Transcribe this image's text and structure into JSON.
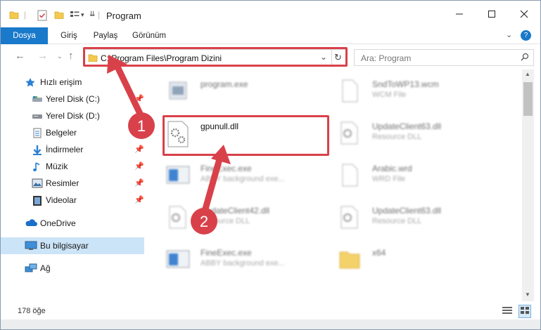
{
  "window": {
    "title": "Program",
    "minimize_icon": "minimize-icon",
    "maximize_icon": "maximize-icon",
    "close_icon": "close-icon"
  },
  "ribbon": {
    "tabs": [
      "Dosya",
      "Giriş",
      "Paylaş",
      "Görünüm"
    ]
  },
  "address": {
    "path": "C:\\Program Files\\Program Dizini",
    "search_placeholder": "Ara: Program"
  },
  "sidebar": {
    "items": [
      {
        "label": "Hızlı erişim",
        "icon": "star-icon"
      },
      {
        "label": "Yerel Disk (C:)",
        "icon": "drive-icon"
      },
      {
        "label": "Yerel Disk (D:)",
        "icon": "drive-icon"
      },
      {
        "label": "Belgeler",
        "icon": "documents-icon"
      },
      {
        "label": "İndirmeler",
        "icon": "download-icon"
      },
      {
        "label": "Müzik",
        "icon": "music-icon"
      },
      {
        "label": "Resimler",
        "icon": "pictures-icon"
      },
      {
        "label": "Videolar",
        "icon": "videos-icon"
      },
      {
        "label": "OneDrive",
        "icon": "cloud-icon"
      },
      {
        "label": "Bu bilgisayar",
        "icon": "computer-icon"
      },
      {
        "label": "Ağ",
        "icon": "network-icon"
      }
    ]
  },
  "files": [
    {
      "name": "program.exe",
      "type": ""
    },
    {
      "name": "SndToWP13.wcm",
      "type": "WCM File"
    },
    {
      "name": "gpunull.dll",
      "type": ""
    },
    {
      "name": "UpdateClient63.dll",
      "type": "Resource DLL"
    },
    {
      "name": "FineExec.exe",
      "type": "ABBY background exe..."
    },
    {
      "name": "Arabic.wrd",
      "type": "WRD File"
    },
    {
      "name": "UpdateClient42.dll",
      "type": "Resource DLL"
    },
    {
      "name": "UpdateClient63.dll",
      "type": "Resource DLL"
    },
    {
      "name": "FineExec.exe",
      "type": "ABBY background exe..."
    },
    {
      "name": "x64",
      "type": ""
    }
  ],
  "annotations": {
    "step1": "1",
    "step2": "2",
    "color": "#d9414a"
  },
  "status": {
    "count": "178 öğe"
  }
}
